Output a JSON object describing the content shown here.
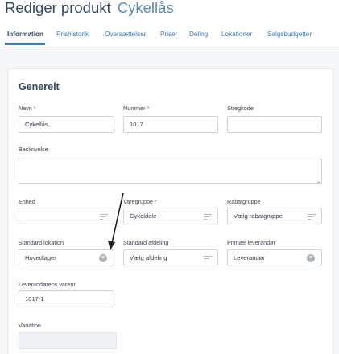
{
  "header": {
    "title": "Rediger produkt",
    "subtitle": "Cykellås"
  },
  "tabs": [
    {
      "label": "Information",
      "active": true
    },
    {
      "label": "Prishistorik"
    },
    {
      "label": "Oversættelser"
    },
    {
      "label": "Priser"
    },
    {
      "label": "Deling"
    },
    {
      "label": "Lokationer"
    },
    {
      "label": "Salgsbudgetter"
    }
  ],
  "section": {
    "title": "Generelt"
  },
  "form": {
    "navn": {
      "label": "Navn",
      "required_mark": "*",
      "value": "Cykellås"
    },
    "nummer": {
      "label": "Nummer",
      "required_mark": "*",
      "value": "1017"
    },
    "stregkode": {
      "label": "Stregkode",
      "value": ""
    },
    "beskrivelse": {
      "label": "Beskrivelse",
      "value": ""
    },
    "enhed": {
      "label": "Enhed",
      "value": ""
    },
    "varegruppe": {
      "label": "Varegruppe",
      "required_mark": "*",
      "value": "Cykeldele"
    },
    "rabatgruppe": {
      "label": "Rabatgruppe",
      "value": "Vælg rabatgruppe"
    },
    "standard_lokation": {
      "label": "Standard lokation",
      "value": "Hovedlager"
    },
    "standard_afdeling": {
      "label": "Standard afdeling",
      "value": "Vælg afdeling"
    },
    "primaer_leverandor": {
      "label": "Primær leverandør",
      "value": "Leverandør"
    },
    "leverandorens_varenr": {
      "label": "Leverandørens varenr.",
      "value": "1017-1"
    },
    "variation": {
      "label": "Variation",
      "value": ""
    }
  },
  "icons": {
    "select": "list-filter-icon",
    "clear": "clear-x-icon",
    "annotation": "arrow-annotation"
  },
  "colors": {
    "accent": "#3d7fb8",
    "required": "#d9534f",
    "title": "#34495e"
  }
}
